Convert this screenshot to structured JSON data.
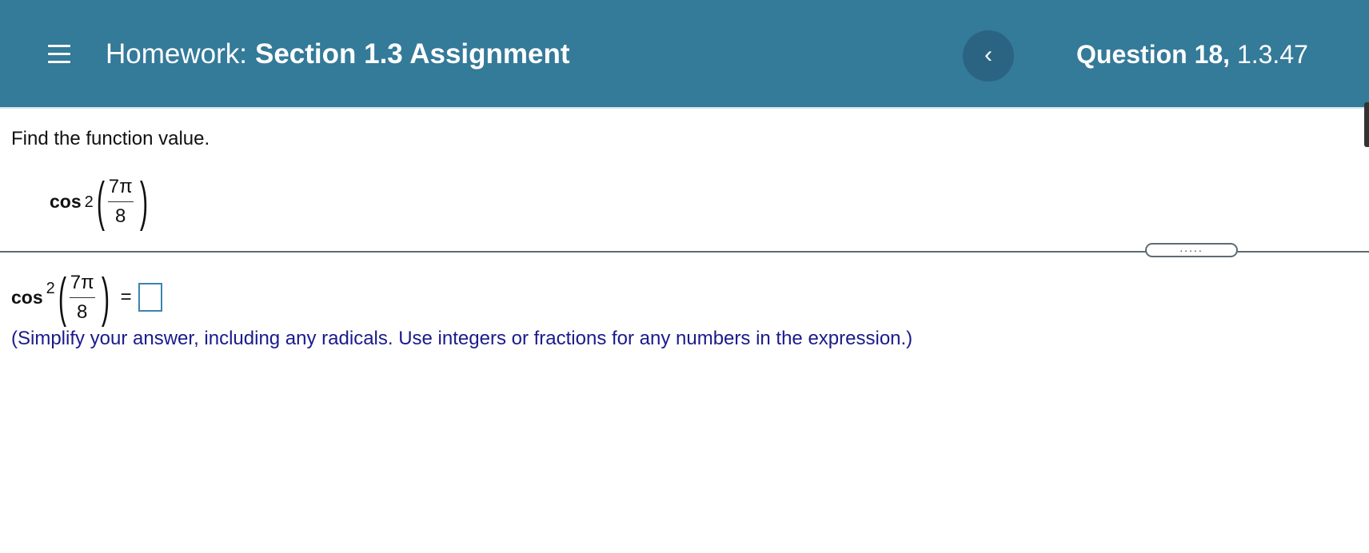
{
  "header": {
    "homework_label": "Homework:",
    "section_title": "Section 1.3 Assignment",
    "back_label": "‹",
    "question_number": "Question 18,",
    "question_id": "1.3.47"
  },
  "question": {
    "instruction": "Find the function value.",
    "expression": {
      "func": "cos",
      "exponent": "2",
      "numerator": "7π",
      "denominator": "8"
    },
    "equals": "=",
    "answer_value": "",
    "hint": "(Simplify your answer, including any radicals. Use integers or fractions for any numbers in the expression.)"
  },
  "divider": {
    "handle_dots": "....."
  },
  "colors": {
    "header_bg": "#347a99",
    "back_button_bg": "#2a6482",
    "hint_text": "#1a1a8c",
    "answer_box_border": "#3b84b0"
  },
  "icons": {
    "menu": "hamburger-menu-icon",
    "back": "chevron-left-icon"
  }
}
